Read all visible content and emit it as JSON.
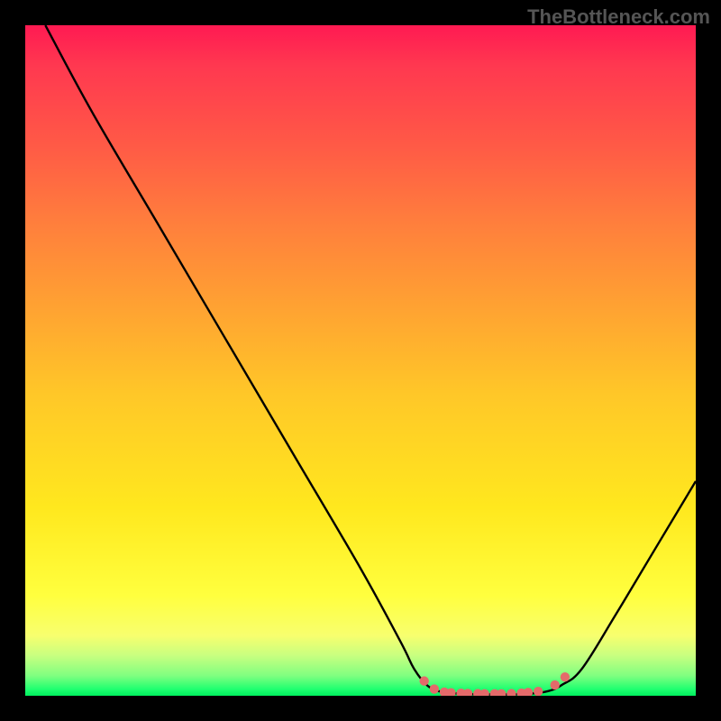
{
  "watermark": "TheBottleneck.com",
  "chart_data": {
    "type": "line",
    "title": "",
    "xlabel": "",
    "ylabel": "",
    "xlim": [
      0,
      100
    ],
    "ylim": [
      0,
      100
    ],
    "series": [
      {
        "name": "curve",
        "points": [
          {
            "x": 3,
            "y": 100
          },
          {
            "x": 10,
            "y": 87
          },
          {
            "x": 20,
            "y": 70
          },
          {
            "x": 30,
            "y": 53
          },
          {
            "x": 40,
            "y": 36
          },
          {
            "x": 50,
            "y": 19
          },
          {
            "x": 56,
            "y": 8
          },
          {
            "x": 58,
            "y": 4
          },
          {
            "x": 60,
            "y": 1.5
          },
          {
            "x": 62,
            "y": 0.6
          },
          {
            "x": 65,
            "y": 0.3
          },
          {
            "x": 70,
            "y": 0.2
          },
          {
            "x": 75,
            "y": 0.3
          },
          {
            "x": 78,
            "y": 0.7
          },
          {
            "x": 80,
            "y": 1.6
          },
          {
            "x": 83,
            "y": 4
          },
          {
            "x": 88,
            "y": 12
          },
          {
            "x": 94,
            "y": 22
          },
          {
            "x": 100,
            "y": 32
          }
        ]
      },
      {
        "name": "dots",
        "points": [
          {
            "x": 59.5,
            "y": 2.2
          },
          {
            "x": 61,
            "y": 1.0
          },
          {
            "x": 62.5,
            "y": 0.55
          },
          {
            "x": 63.5,
            "y": 0.45
          },
          {
            "x": 65,
            "y": 0.38
          },
          {
            "x": 66,
            "y": 0.35
          },
          {
            "x": 67.5,
            "y": 0.32
          },
          {
            "x": 68.5,
            "y": 0.3
          },
          {
            "x": 70,
            "y": 0.29
          },
          {
            "x": 71,
            "y": 0.3
          },
          {
            "x": 72.5,
            "y": 0.32
          },
          {
            "x": 74,
            "y": 0.4
          },
          {
            "x": 75,
            "y": 0.5
          },
          {
            "x": 76.5,
            "y": 0.65
          },
          {
            "x": 79,
            "y": 1.6
          },
          {
            "x": 80.5,
            "y": 2.8
          }
        ]
      }
    ],
    "colors": {
      "curve": "#000000",
      "dots": "#e46a6a"
    }
  }
}
